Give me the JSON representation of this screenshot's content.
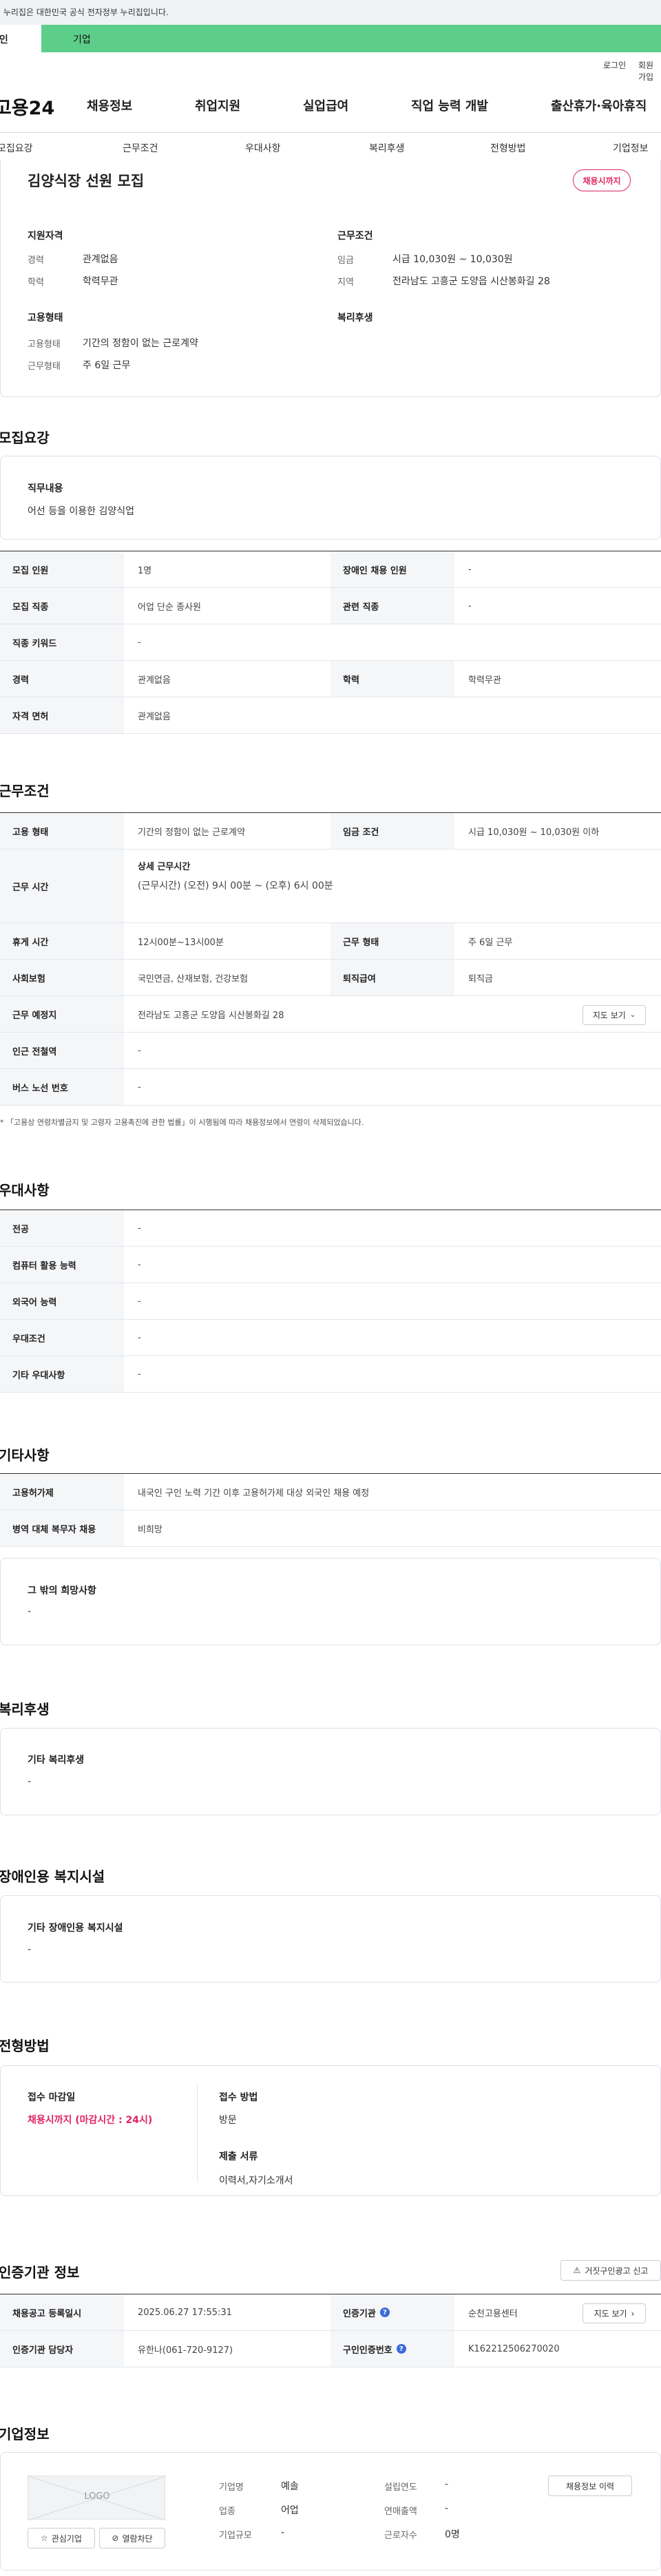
{
  "top_notice": "이 누리집은 대한민국 공식 전자정부 누리집입니다.",
  "tabs": {
    "personal": "개인",
    "company": "기업"
  },
  "util": {
    "login": "로그인",
    "join": "회원가입"
  },
  "logo": "고용24",
  "gnb": [
    "채용정보",
    "취업지원",
    "실업급여",
    "직업 능력 개발",
    "출산휴가·육아휴직"
  ],
  "subnav": [
    "모집요강",
    "근무조건",
    "우대사항",
    "복리후생",
    "전형방법",
    "기업정보"
  ],
  "job": {
    "title": "김양식장 선원 모집",
    "badge": "채용시까지",
    "qual_h": "지원자격",
    "career_k": "경력",
    "career_v": "관계없음",
    "edu_k": "학력",
    "edu_v": "학력무관",
    "cond_h": "근무조건",
    "wage_k": "임금",
    "wage_v": "시급 10,030원 ~ 10,030원",
    "loc_k": "지역",
    "loc_v": "전라남도 고흥군 도양읍 시산봉화길 28",
    "emp_h": "고용형태",
    "emptype_k": "고용형태",
    "emptype_v": "기간의 정함이 없는 근로계약",
    "worktype_k": "근무형태",
    "worktype_v": "주 6일 근무",
    "welfare_h": "복리후생"
  },
  "recruit": {
    "heading": "모집요강",
    "duty_h": "직무내용",
    "duty_v": "어선 등을 이용한 김양식업",
    "rows": [
      [
        "모집 인원",
        "1명",
        "장애인 채용 인원",
        "-"
      ],
      [
        "모집 직종",
        "어업 단순 종사원",
        "관련 직종",
        "-"
      ],
      [
        "직종 키워드",
        "-"
      ],
      [
        "경력",
        "관계없음",
        "학력",
        "학력무관"
      ],
      [
        "자격 면허",
        "관계없음"
      ]
    ]
  },
  "work": {
    "heading": "근무조건",
    "emp_k": "고용 형태",
    "emp_v": "기간의 정함이 없는 근로계약",
    "wage_k": "임금 조건",
    "wage_v": "시급 10,030원 ~ 10,030원 이하",
    "time_k": "근무 시간",
    "time_h": "상세 근무시간",
    "time_v": "(근무시간) (오전) 9시 00분 ~ (오후) 6시 00분",
    "rest_k": "휴게 시간",
    "rest_v": "12시00분~13시00분",
    "form_k": "근무 형태",
    "form_v": "주 6일 근무",
    "ins_k": "사회보험",
    "ins_v": "국민연금, 산재보험, 건강보험",
    "sev_k": "퇴직급여",
    "sev_v": "퇴직금",
    "place_k": "근무 예정지",
    "place_v": "전라남도 고흥군 도양읍 시산봉화길 28",
    "map_btn": "지도 보기",
    "subway_k": "인근 전철역",
    "subway_v": "-",
    "bus_k": "버스 노선 번호",
    "bus_v": "-",
    "note": "「고용상 연령차별금지 및 고령자 고용촉진에 관한 법률」이 시행됨에 따라 채용정보에서 연령이 삭제되었습니다."
  },
  "pref": {
    "heading": "우대사항",
    "rows": [
      [
        "전공",
        "-"
      ],
      [
        "컴퓨터 활용 능력",
        "-"
      ],
      [
        "외국어 능력",
        "-"
      ],
      [
        "우대조건",
        "-"
      ],
      [
        "기타 우대사항",
        "-"
      ]
    ]
  },
  "etc": {
    "heading": "기타사항",
    "rows": [
      [
        "고용허가제",
        "내국인 구인 노력 기간 이후 고용허가제 대상 외국인 채용 예정"
      ],
      [
        "병역 대체 복무자 채용",
        "비희망"
      ]
    ],
    "other_h": "그 밖의 희망사항",
    "other_v": "-"
  },
  "welfare": {
    "heading": "복리후생",
    "box_h": "기타 복리후생",
    "box_v": "-"
  },
  "disab": {
    "heading": "장애인용 복지시설",
    "box_h": "기타 장애인용 복지시설",
    "box_v": "-"
  },
  "process": {
    "heading": "전형방법",
    "deadline_h": "접수 마감일",
    "deadline_v": "채용시까지 (마감시간 : 24시)",
    "method_h": "접수 방법",
    "method_v": "방문",
    "docs_h": "제출 서류",
    "docs_v": "이력서,자기소개서"
  },
  "cert": {
    "heading": "인증기관 정보",
    "report_btn": "거짓구인광고 신고",
    "reg_k": "채용공고 등록일시",
    "reg_v": "2025.06.27 17:55:31",
    "org_k": "인증기관",
    "org_v": "순천고용센터",
    "map_btn": "지도 보기",
    "mgr_k": "인증기관 담당자",
    "mgr_v": "유한나(061-720-9127)",
    "num_k": "구인인증번호",
    "num_v": "K162212506270020"
  },
  "company": {
    "heading": "기업정보",
    "logo": "LOGO",
    "fav_btn": "관심기업",
    "block_btn": "열람차단",
    "name_k": "기업명",
    "name_v": "예솔",
    "ind_k": "업종",
    "ind_v": "어업",
    "size_k": "기업규모",
    "size_v": "-",
    "est_k": "설립연도",
    "est_v": "-",
    "sales_k": "연매출액",
    "sales_v": "-",
    "emp_k": "근로자수",
    "emp_v": "0명",
    "history_btn": "채용정보 이력"
  }
}
